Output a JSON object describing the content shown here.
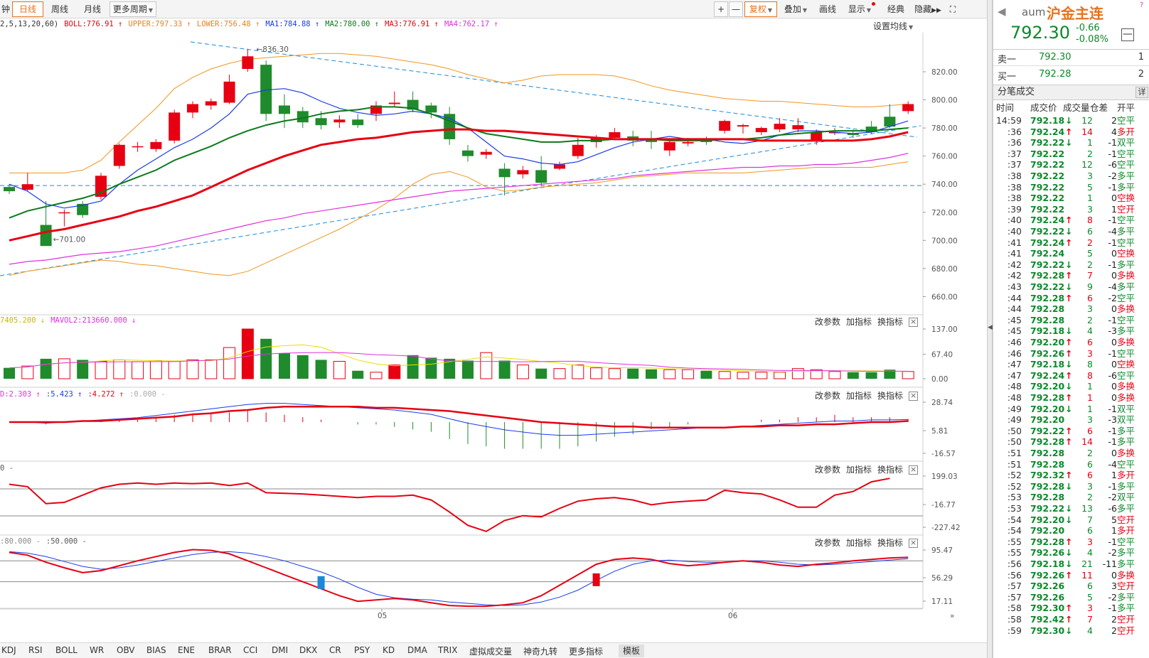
{
  "toolbar": {
    "left": [
      "钟",
      "日线",
      "周线",
      "月线",
      "更多周期"
    ],
    "right": [
      "+",
      "—",
      "复权",
      "叠加",
      "画线",
      "显示",
      "经典",
      "隐藏",
      "⛶"
    ]
  },
  "legend_main": [
    {
      "text": "2,5,13,20,60)",
      "color": "#333"
    },
    {
      "text": "BOLL:776.91 ↑",
      "color": "#e60012"
    },
    {
      "text": "UPPER:797.33 ↑",
      "color": "#e8821c"
    },
    {
      "text": "LOWER:756.48 ↑",
      "color": "#e8821c"
    },
    {
      "text": "MA1:784.88 ↑",
      "color": "#1a3be8"
    },
    {
      "text": "MA2:780.00 ↑",
      "color": "#0a7a1a"
    },
    {
      "text": "MA3:776.91 ↑",
      "color": "#e60012"
    },
    {
      "text": "MA4:762.17 ↑",
      "color": "#e030e0"
    }
  ],
  "set_ma": "设置均线",
  "legend_vol": [
    {
      "text": "7405.200 ↓",
      "color": "#c8b800"
    },
    {
      "text": "MAVOL2:213660.000 ↓",
      "color": "#e030e0"
    }
  ],
  "legend_macd": [
    {
      "text": "D:2.303 ↑",
      "color": "#e030e0"
    },
    {
      "text": ":5.423 ↑",
      "color": "#1a3be8"
    },
    {
      "text": ":4.272 ↑",
      "color": "#e60012"
    },
    {
      "text": ":0.000 -",
      "color": "#aaa"
    }
  ],
  "legend_cci": [
    {
      "text": "0 -",
      "color": "#555"
    }
  ],
  "legend_kd": [
    {
      "text": ":80.000 -",
      "color": "#888"
    },
    {
      "text": ":50.000 -",
      "color": "#555"
    }
  ],
  "pane_ctl": [
    "改参数",
    "加指标",
    "换指标"
  ],
  "y_main": [
    "820.00",
    "800.00",
    "780.00",
    "760.00",
    "740.00",
    "720.00",
    "700.00",
    "680.00",
    "660.00"
  ],
  "y_vol": [
    "137.00",
    "67.40",
    "0.00"
  ],
  "y_macd": [
    "28.74",
    "5.81",
    "-16.57"
  ],
  "y_cci": [
    "199.03",
    "-16.77",
    "-227.42"
  ],
  "y_kd": [
    "95.47",
    "56.29",
    "17.11"
  ],
  "x_labels": [
    "05",
    "06"
  ],
  "annotations": {
    "high": "836.30",
    "low": "701.00"
  },
  "bottom_tabs": [
    "KDJ",
    "RSI",
    "BOLL",
    "WR",
    "OBV",
    "BIAS",
    "ENE",
    "BRAR",
    "CCI",
    "DMI",
    "DKX",
    "CR",
    "PSY",
    "KD",
    "DMA",
    "TRIX",
    "虚拟成交量",
    "神奇九转",
    "更多指标",
    "模板"
  ],
  "quote": {
    "code": "aum",
    "name": "沪金主连",
    "price": "792.30",
    "change": "-0.66",
    "change_pct": "-0.08%",
    "ask_label": "卖一",
    "ask_price": "792.30",
    "ask_vol": "1",
    "bid_label": "买一",
    "bid_price": "792.28",
    "bid_vol": "2",
    "section": "分笔成交",
    "detail": "详"
  },
  "trades_header": [
    "时间",
    "成交价",
    "成交量",
    "仓差",
    "开平"
  ],
  "trades": [
    [
      "14:59",
      "792.18",
      "↓",
      "12",
      "2",
      "空平"
    ],
    [
      ":36",
      "792.24",
      "↑",
      "14",
      "4",
      "多开"
    ],
    [
      ":36",
      "792.22",
      "↓",
      "1",
      "-1",
      "双平"
    ],
    [
      ":37",
      "792.22",
      "",
      "2",
      "-1",
      "空平"
    ],
    [
      ":37",
      "792.22",
      "",
      "12",
      "-6",
      "空平"
    ],
    [
      ":38",
      "792.22",
      "",
      "3",
      "-2",
      "多平"
    ],
    [
      ":38",
      "792.22",
      "",
      "5",
      "-1",
      "多平"
    ],
    [
      ":38",
      "792.22",
      "",
      "1",
      "0",
      "空换"
    ],
    [
      ":39",
      "792.22",
      "",
      "3",
      "1",
      "空开"
    ],
    [
      ":40",
      "792.24",
      "↑",
      "8",
      "-1",
      "空平"
    ],
    [
      ":40",
      "792.22",
      "↓",
      "6",
      "-4",
      "多平"
    ],
    [
      ":41",
      "792.24",
      "↑",
      "2",
      "-1",
      "空平"
    ],
    [
      ":41",
      "792.24",
      "",
      "5",
      "0",
      "空换"
    ],
    [
      ":42",
      "792.22",
      "↓",
      "2",
      "-1",
      "多平"
    ],
    [
      ":42",
      "792.28",
      "↑",
      "7",
      "0",
      "多换"
    ],
    [
      ":43",
      "792.22",
      "↓",
      "9",
      "-4",
      "多平"
    ],
    [
      ":44",
      "792.28",
      "↑",
      "6",
      "-2",
      "空平"
    ],
    [
      ":44",
      "792.28",
      "",
      "3",
      "0",
      "多换"
    ],
    [
      ":45",
      "792.28",
      "",
      "2",
      "-1",
      "空平"
    ],
    [
      ":45",
      "792.18",
      "↓",
      "4",
      "-3",
      "多平"
    ],
    [
      ":46",
      "792.20",
      "↑",
      "6",
      "0",
      "多换"
    ],
    [
      ":46",
      "792.26",
      "↑",
      "3",
      "-1",
      "空平"
    ],
    [
      ":47",
      "792.18",
      "↓",
      "8",
      "0",
      "空换"
    ],
    [
      ":47",
      "792.24",
      "↑",
      "8",
      "-6",
      "空平"
    ],
    [
      ":48",
      "792.20",
      "↓",
      "1",
      "0",
      "多换"
    ],
    [
      ":48",
      "792.28",
      "↑",
      "1",
      "0",
      "多换"
    ],
    [
      ":49",
      "792.20",
      "↓",
      "1",
      "-1",
      "双平"
    ],
    [
      ":49",
      "792.20",
      "",
      "3",
      "-3",
      "双平"
    ],
    [
      ":50",
      "792.22",
      "↑",
      "6",
      "-1",
      "多平"
    ],
    [
      ":50",
      "792.28",
      "↑",
      "14",
      "-1",
      "多平"
    ],
    [
      ":51",
      "792.28",
      "",
      "2",
      "0",
      "多换"
    ],
    [
      ":51",
      "792.28",
      "",
      "6",
      "-4",
      "空平"
    ],
    [
      ":52",
      "792.32",
      "↑",
      "6",
      "1",
      "多开"
    ],
    [
      ":52",
      "792.28",
      "↓",
      "3",
      "-1",
      "多平"
    ],
    [
      ":53",
      "792.28",
      "",
      "2",
      "-2",
      "双平"
    ],
    [
      ":53",
      "792.22",
      "↓",
      "13",
      "-6",
      "多平"
    ],
    [
      ":54",
      "792.20",
      "↓",
      "7",
      "5",
      "空开"
    ],
    [
      ":54",
      "792.20",
      "",
      "6",
      "1",
      "多开"
    ],
    [
      ":55",
      "792.28",
      "↑",
      "3",
      "-1",
      "空平"
    ],
    [
      ":55",
      "792.26",
      "↓",
      "4",
      "-2",
      "多平"
    ],
    [
      ":56",
      "792.18",
      "↓",
      "21",
      "-11",
      "多平"
    ],
    [
      ":56",
      "792.26",
      "↑",
      "11",
      "0",
      "多换"
    ],
    [
      ":57",
      "792.26",
      "",
      "6",
      "3",
      "空开"
    ],
    [
      ":57",
      "792.26",
      "",
      "5",
      "-2",
      "多平"
    ],
    [
      ":58",
      "792.30",
      "↑",
      "3",
      "-1",
      "多平"
    ],
    [
      ":58",
      "792.42",
      "↑",
      "7",
      "2",
      "空开"
    ],
    [
      ":59",
      "792.30",
      "↓",
      "4",
      "2",
      "空开"
    ]
  ],
  "chart_data": {
    "type": "candlestick",
    "candles": [
      {
        "o": 738,
        "c": 735,
        "h": 740,
        "l": 733
      },
      {
        "o": 736,
        "c": 740,
        "h": 748,
        "l": 735
      },
      {
        "o": 711,
        "c": 696,
        "h": 728,
        "l": 701
      },
      {
        "o": 720,
        "c": 720,
        "h": 722,
        "l": 710
      },
      {
        "o": 726,
        "c": 718,
        "h": 728,
        "l": 716
      },
      {
        "o": 731,
        "c": 746,
        "h": 748,
        "l": 729
      },
      {
        "o": 753,
        "c": 768,
        "h": 769,
        "l": 751
      },
      {
        "o": 767,
        "c": 767,
        "h": 770,
        "l": 763
      },
      {
        "o": 765,
        "c": 770,
        "h": 772,
        "l": 763
      },
      {
        "o": 771,
        "c": 791,
        "h": 793,
        "l": 769
      },
      {
        "o": 791,
        "c": 797,
        "h": 799,
        "l": 787
      },
      {
        "o": 796,
        "c": 799,
        "h": 801,
        "l": 793
      },
      {
        "o": 798,
        "c": 813,
        "h": 818,
        "l": 797
      },
      {
        "o": 822,
        "c": 831,
        "h": 836.3,
        "l": 820
      },
      {
        "o": 825,
        "c": 790,
        "h": 828,
        "l": 785
      },
      {
        "o": 796,
        "c": 790,
        "h": 804,
        "l": 780
      },
      {
        "o": 792,
        "c": 784,
        "h": 795,
        "l": 780
      },
      {
        "o": 787,
        "c": 782,
        "h": 792,
        "l": 779
      },
      {
        "o": 784,
        "c": 786,
        "h": 789,
        "l": 780
      },
      {
        "o": 786,
        "c": 782,
        "h": 790,
        "l": 780
      },
      {
        "o": 790,
        "c": 796,
        "h": 799,
        "l": 785
      },
      {
        "o": 797,
        "c": 798,
        "h": 806,
        "l": 795
      },
      {
        "o": 800,
        "c": 793,
        "h": 806,
        "l": 791
      },
      {
        "o": 796,
        "c": 791,
        "h": 798,
        "l": 787
      },
      {
        "o": 790,
        "c": 772,
        "h": 795,
        "l": 768
      },
      {
        "o": 764,
        "c": 760,
        "h": 768,
        "l": 756
      },
      {
        "o": 761,
        "c": 763,
        "h": 765,
        "l": 758
      },
      {
        "o": 751,
        "c": 745,
        "h": 755,
        "l": 732
      },
      {
        "o": 747,
        "c": 750,
        "h": 753,
        "l": 744
      },
      {
        "o": 750,
        "c": 741,
        "h": 760,
        "l": 739
      },
      {
        "o": 751,
        "c": 754,
        "h": 756,
        "l": 750
      },
      {
        "o": 760,
        "c": 768,
        "h": 773,
        "l": 758
      },
      {
        "o": 770,
        "c": 773,
        "h": 775,
        "l": 766
      },
      {
        "o": 773,
        "c": 777,
        "h": 780,
        "l": 772
      },
      {
        "o": 774,
        "c": 771,
        "h": 778,
        "l": 767
      },
      {
        "o": 772,
        "c": 770,
        "h": 778,
        "l": 765
      },
      {
        "o": 764,
        "c": 770,
        "h": 772,
        "l": 760
      },
      {
        "o": 769,
        "c": 770,
        "h": 773,
        "l": 767
      },
      {
        "o": 771,
        "c": 770,
        "h": 774,
        "l": 768
      },
      {
        "o": 778,
        "c": 785,
        "h": 786,
        "l": 776
      },
      {
        "o": 781,
        "c": 782,
        "h": 783,
        "l": 776
      },
      {
        "o": 777,
        "c": 780,
        "h": 781,
        "l": 775
      },
      {
        "o": 779,
        "c": 783,
        "h": 787,
        "l": 777
      },
      {
        "o": 779,
        "c": 782,
        "h": 787,
        "l": 777
      },
      {
        "o": 771,
        "c": 777,
        "h": 779,
        "l": 768
      },
      {
        "o": 777,
        "c": 777,
        "h": 780,
        "l": 775
      },
      {
        "o": 776,
        "c": 775,
        "h": 779,
        "l": 773
      },
      {
        "o": 781,
        "c": 777,
        "h": 785,
        "l": 776
      },
      {
        "o": 788,
        "c": 781,
        "h": 797,
        "l": 780
      },
      {
        "o": 792,
        "c": 797,
        "h": 799,
        "l": 790
      }
    ],
    "ma1": [
      740,
      735,
      726,
      723,
      725,
      728,
      740,
      750,
      758,
      766,
      772,
      780,
      790,
      804,
      807,
      808,
      805,
      799,
      794,
      791,
      789,
      790,
      792,
      790,
      787,
      780,
      770,
      760,
      758,
      755,
      754,
      756,
      761,
      766,
      770,
      772,
      774,
      772,
      772,
      770,
      769,
      771,
      775,
      778,
      778,
      777,
      776,
      777,
      781,
      785
    ],
    "ma2": [
      716,
      721,
      724,
      727,
      730,
      734,
      740,
      745,
      750,
      757,
      762,
      767,
      773,
      778,
      782,
      785,
      787,
      790,
      792,
      793,
      795,
      795,
      794,
      790,
      785,
      780,
      776,
      774,
      772,
      770,
      770,
      771,
      771,
      772,
      772,
      772,
      771,
      771,
      771,
      772,
      772,
      773,
      775,
      776,
      777,
      778,
      778,
      778,
      779,
      780
    ],
    "ma3": [
      700,
      703,
      706,
      708,
      711,
      714,
      717,
      721,
      724,
      728,
      732,
      738,
      744,
      750,
      755,
      760,
      764,
      768,
      770,
      772,
      773,
      775,
      777,
      778,
      779,
      779,
      778,
      778,
      777,
      776,
      775,
      774,
      773,
      772,
      772,
      772,
      772,
      772,
      772,
      772,
      772,
      771,
      771,
      771,
      771,
      771,
      771,
      772,
      774,
      777
    ],
    "ma4": [
      683,
      685,
      686,
      688,
      690,
      691,
      692,
      694,
      696,
      699,
      702,
      705,
      708,
      711,
      714,
      716,
      719,
      721,
      723,
      725,
      727,
      729,
      731,
      733,
      735,
      736,
      737,
      738,
      739,
      740,
      741,
      742,
      743,
      744,
      746,
      747,
      748,
      749,
      750,
      751,
      752,
      752,
      753,
      753,
      754,
      754,
      755,
      757,
      759,
      762
    ],
    "upper": [
      748,
      748,
      748,
      748,
      750,
      757,
      770,
      782,
      794,
      808,
      816,
      822,
      826,
      829,
      830,
      831,
      832,
      833,
      833,
      832,
      831,
      829,
      827,
      825,
      822,
      818,
      815,
      812,
      814,
      817,
      818,
      818,
      818,
      817,
      814,
      810,
      807,
      805,
      803,
      801,
      800,
      799,
      799,
      798,
      797,
      796,
      795,
      795,
      796,
      797
    ],
    "lower": [
      675,
      678,
      680,
      682,
      684,
      686,
      685,
      683,
      682,
      680,
      678,
      676,
      675,
      678,
      684,
      690,
      696,
      702,
      708,
      715,
      722,
      730,
      740,
      747,
      749,
      745,
      738,
      735,
      736,
      738,
      739,
      740,
      741,
      743,
      745,
      746,
      747,
      748,
      748,
      748,
      748,
      749,
      750,
      751,
      752,
      752,
      752,
      752,
      754,
      756
    ],
    "volume": [
      30,
      35,
      55,
      55,
      52,
      48,
      52,
      47,
      50,
      48,
      52,
      52,
      86,
      137,
      110,
      70,
      65,
      52,
      48,
      22,
      18,
      38,
      65,
      58,
      55,
      50,
      72,
      50,
      38,
      28,
      28,
      38,
      30,
      28,
      28,
      26,
      25,
      25,
      22,
      20,
      18,
      18,
      18,
      28,
      25,
      20,
      18,
      18,
      25,
      20
    ],
    "macd_dif": [
      0,
      0,
      -1,
      0,
      1,
      2,
      3,
      4,
      6,
      8,
      10,
      12,
      14,
      16,
      17,
      17,
      16,
      15,
      14,
      13,
      12,
      11,
      9,
      7,
      3,
      -1,
      -4,
      -7,
      -9,
      -11,
      -12,
      -12,
      -11,
      -10,
      -9,
      -8,
      -7,
      -6,
      -5,
      -5,
      -4,
      -3,
      -2,
      -1,
      0,
      1,
      1,
      2,
      2,
      2.303
    ],
    "macd_dea": [
      0,
      0,
      0,
      0,
      1,
      1,
      2,
      3,
      4,
      5,
      7,
      8,
      10,
      11,
      13,
      14,
      14,
      14,
      14,
      14,
      13,
      13,
      12,
      11,
      10,
      8,
      6,
      4,
      2,
      0,
      -1,
      -2,
      -3,
      -4,
      -4,
      -5,
      -5,
      -5,
      -5,
      -5,
      -4,
      -4,
      -3,
      -3,
      -2,
      -2,
      -1,
      0,
      0,
      1
    ],
    "cci": [
      150,
      130,
      -10,
      0,
      60,
      120,
      150,
      160,
      150,
      160,
      155,
      160,
      140,
      160,
      80,
      75,
      70,
      60,
      50,
      40,
      50,
      50,
      60,
      20,
      -80,
      -190,
      -240,
      -150,
      -110,
      -120,
      -50,
      10,
      30,
      40,
      20,
      -20,
      0,
      10,
      20,
      100,
      80,
      70,
      20,
      -40,
      -40,
      60,
      90,
      170,
      199
    ],
    "kd_k": [
      92,
      88,
      78,
      70,
      63,
      66,
      73,
      80,
      86,
      92,
      96,
      95,
      90,
      80,
      70,
      60,
      50,
      40,
      30,
      22,
      24,
      26,
      24,
      20,
      16,
      15,
      15,
      17,
      20,
      30,
      45,
      60,
      75,
      82,
      84,
      82,
      76,
      73,
      75,
      78,
      80,
      78,
      74,
      72,
      75,
      77,
      80,
      82,
      84,
      85
    ],
    "kd_d": [
      93,
      91,
      86,
      79,
      72,
      68,
      70,
      74,
      79,
      84,
      89,
      92,
      93,
      91,
      86,
      80,
      72,
      64,
      54,
      42,
      32,
      27,
      25,
      24,
      21,
      19,
      17,
      16,
      17,
      21,
      28,
      38,
      52,
      65,
      75,
      80,
      81,
      79,
      78,
      78,
      80,
      80,
      78,
      75,
      74,
      75,
      77,
      79,
      81,
      83
    ]
  }
}
